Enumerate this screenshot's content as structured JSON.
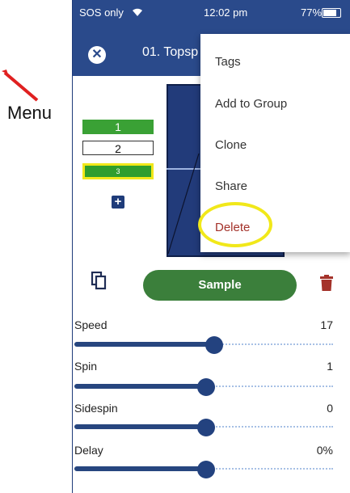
{
  "annotation": {
    "menu_caption": "Menu"
  },
  "status_bar": {
    "left": "SOS only",
    "time": "12:02 pm",
    "battery": "77%"
  },
  "app_bar": {
    "title": "01. Topsp"
  },
  "balls": [
    "1",
    "2",
    "3"
  ],
  "menu": {
    "items": [
      "Tags",
      "Add to Group",
      "Clone",
      "Share",
      "Delete"
    ],
    "highlight_color": "#f1e81a"
  },
  "actions": {
    "sample_label": "Sample"
  },
  "sliders": [
    {
      "label": "Speed",
      "value": "17",
      "level": 0.54
    },
    {
      "label": "Spin",
      "value": "1",
      "level": 0.51
    },
    {
      "label": "Sidespin",
      "value": "0",
      "level": 0.51
    },
    {
      "label": "Delay",
      "value": "0%",
      "level": 0.51
    }
  ],
  "colors": {
    "primary": "#2a4a8b",
    "green": "#3aa135",
    "delete_red": "#a4322a"
  },
  "icons": [
    "wifi-icon",
    "battery-icon",
    "close-icon",
    "add-icon",
    "copy-icon",
    "trash-icon",
    "arrow-icon"
  ]
}
